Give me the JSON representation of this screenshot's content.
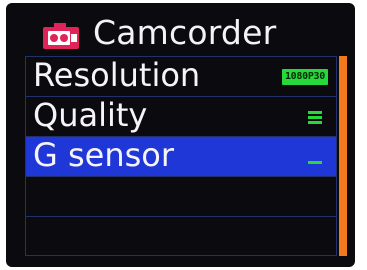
{
  "header": {
    "title": "Camcorder",
    "icon": "camcorder-icon"
  },
  "menu": {
    "items": [
      {
        "label": "Resolution",
        "value": "1080P30",
        "selected": false
      },
      {
        "label": "Quality",
        "value_icon": "quality-high-icon",
        "selected": false
      },
      {
        "label": "G sensor",
        "value_icon": "gsensor-low-icon",
        "selected": true
      },
      {
        "label": "",
        "selected": false
      },
      {
        "label": "",
        "selected": false
      }
    ]
  },
  "scrollbar": {
    "visible_fraction": 1.0
  },
  "colors": {
    "background": "#0b0a0e",
    "highlight": "#1f37d6",
    "accent_green": "#27d83a",
    "scrollbar": "#f07a1d",
    "icon_red": "#e0245a"
  }
}
